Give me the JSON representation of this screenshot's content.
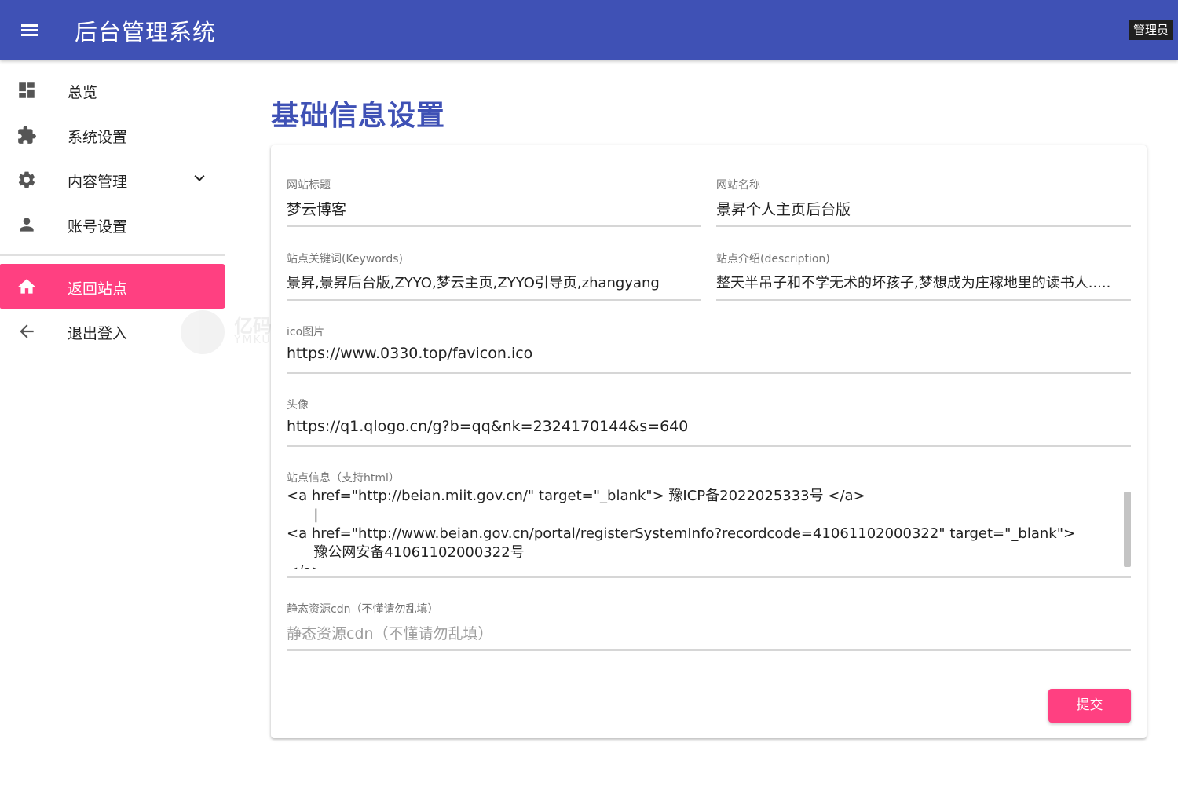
{
  "app": {
    "title": "后台管理系统",
    "role_badge": "管理员"
  },
  "sidebar": {
    "items": [
      {
        "label": "总览",
        "icon": "dashboard-icon"
      },
      {
        "label": "系统设置",
        "icon": "puzzle-icon"
      },
      {
        "label": "内容管理",
        "icon": "gear-icon",
        "expandable": true
      },
      {
        "label": "账号设置",
        "icon": "person-icon"
      },
      {
        "label": "返回站点",
        "icon": "home-icon",
        "active": true
      },
      {
        "label": "退出登入",
        "icon": "arrow-left-icon"
      }
    ]
  },
  "watermark": {
    "text": "亿码酷站",
    "sub": "YMKUZHAN"
  },
  "page": {
    "title": "基础信息设置"
  },
  "form": {
    "site_title": {
      "label": "网站标题",
      "value": "梦云博客"
    },
    "site_name": {
      "label": "网站名称",
      "value": "景昇个人主页后台版"
    },
    "keywords": {
      "label": "站点关键词(Keywords)",
      "value": "景昇,景昇后台版,ZYYO,梦云主页,ZYYO引导页,zhangyang"
    },
    "description": {
      "label": "站点介绍(description)",
      "value": "整天半吊子和不学无术的坏孩子,梦想成为庄稼地里的读书人....."
    },
    "ico": {
      "label": "ico图片",
      "value": "https://www.0330.top/favicon.ico"
    },
    "avatar": {
      "label": "头像",
      "value": "https://q1.qlogo.cn/g?b=qq&nk=2324170144&s=640"
    },
    "site_info": {
      "label": "站点信息（支持html）",
      "lines": [
        "<a href=\"http://beian.miit.gov.cn/\" target=\"_blank\"> 豫ICP备2022025333号 </a>",
        "      |",
        "<a href=\"http://www.beian.gov.cn/portal/registerSystemInfo?recordcode=41061102000322\" target=\"_blank\">",
        "      豫公网安备41061102000322号",
        "</a>"
      ]
    },
    "cdn": {
      "label": "静态资源cdn（不懂请勿乱填）",
      "placeholder": "静态资源cdn（不懂请勿乱填）"
    },
    "submit_label": "提交"
  },
  "colors": {
    "primary": "#3f51b5",
    "accent": "#ff4081"
  }
}
